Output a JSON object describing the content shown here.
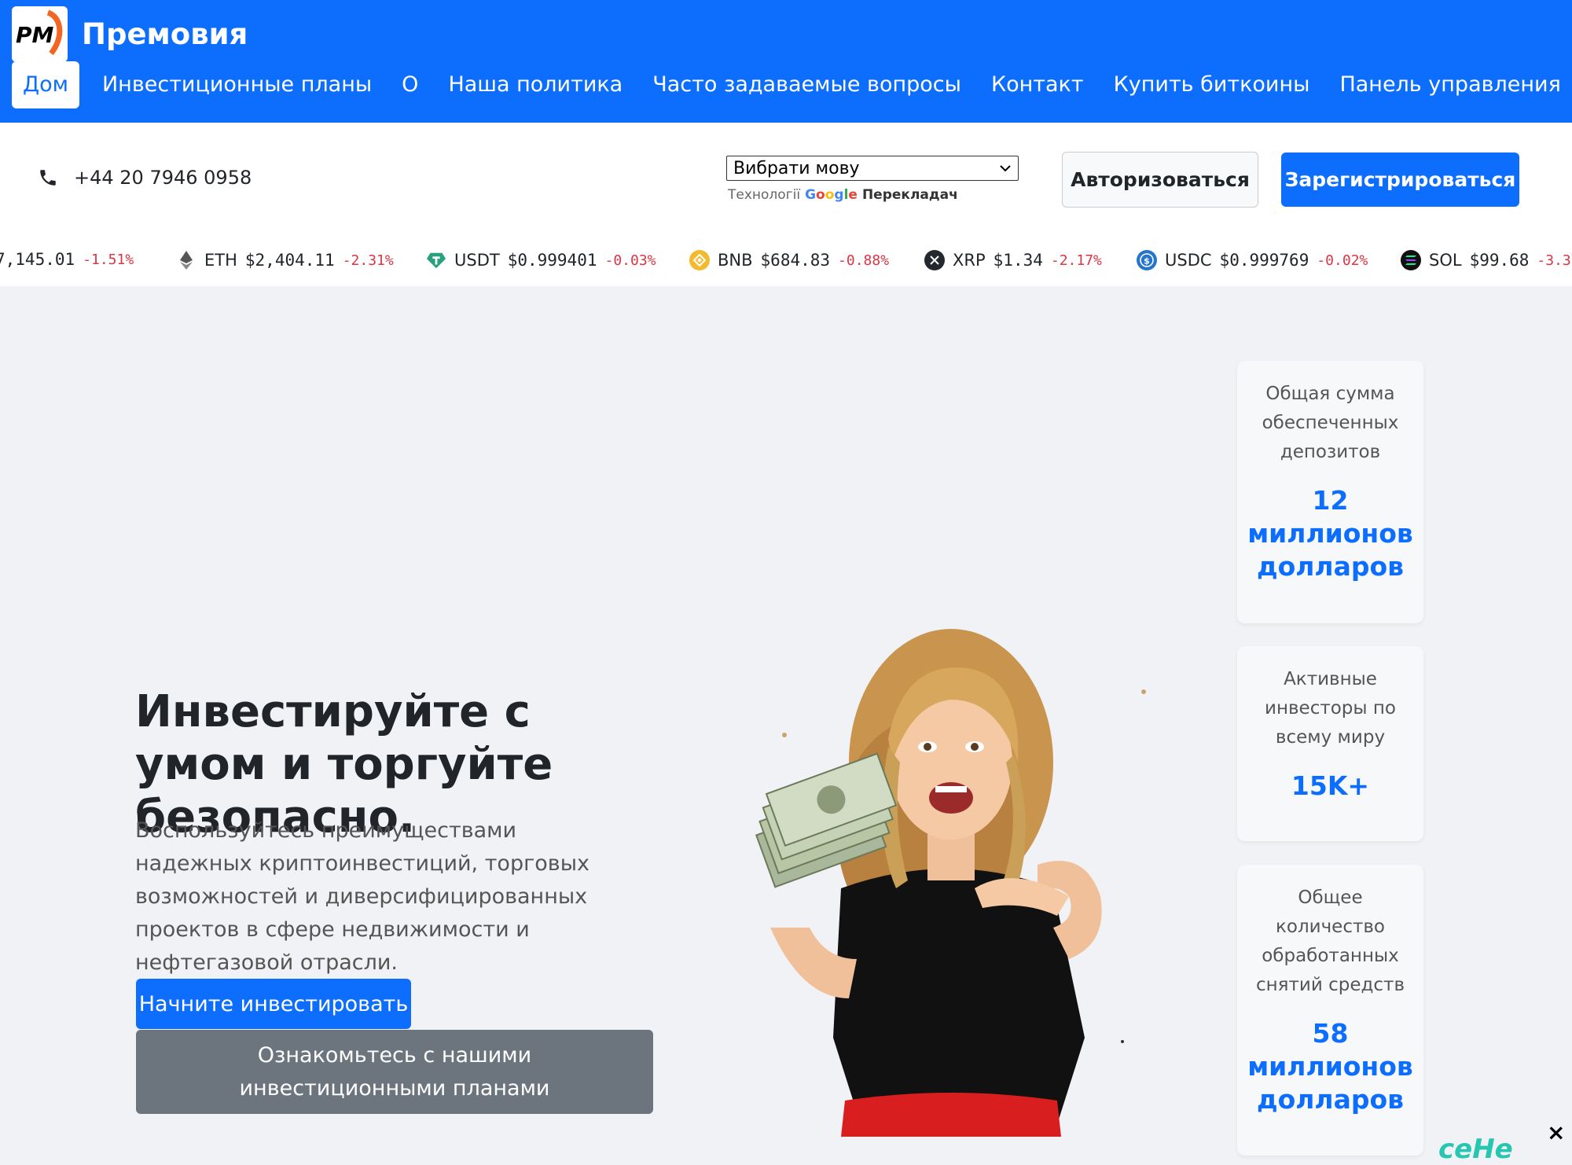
{
  "brand": {
    "name": "Премовия",
    "logo_text": "PM"
  },
  "nav": {
    "items": [
      {
        "label": "Дом",
        "active": true
      },
      {
        "label": "Инвестиционные планы",
        "active": false
      },
      {
        "label": "О",
        "active": false
      },
      {
        "label": "Наша политика",
        "active": false
      },
      {
        "label": "Часто задаваемые вопросы",
        "active": false
      },
      {
        "label": "Контакт",
        "active": false
      },
      {
        "label": "Купить биткоины",
        "active": false
      },
      {
        "label": "Панель управления",
        "active": false
      }
    ]
  },
  "contact": {
    "phone": "+44 20 7946 0958"
  },
  "translate": {
    "select_value": "Вибрати мову",
    "powered_prefix": "Технології",
    "google": "Google",
    "service": "Перекладач"
  },
  "auth": {
    "login_label": "Авторизоваться",
    "register_label": "Зарегистрироваться"
  },
  "ticker": [
    {
      "symbol": "",
      "price": "7,145.01",
      "change": "-1.51%",
      "icon": "btc-icon",
      "color": "#f7931a"
    },
    {
      "symbol": "ETH",
      "price": "$2,404.11",
      "change": "-2.31%",
      "icon": "eth-icon",
      "color": "#627eea"
    },
    {
      "symbol": "USDT",
      "price": "$0.999401",
      "change": "-0.03%",
      "icon": "usdt-icon",
      "color": "#26a17b"
    },
    {
      "symbol": "BNB",
      "price": "$684.83",
      "change": "-0.88%",
      "icon": "bnb-icon",
      "color": "#f3ba2f"
    },
    {
      "symbol": "XRP",
      "price": "$1.34",
      "change": "-2.17%",
      "icon": "xrp-icon",
      "color": "#23292f"
    },
    {
      "symbol": "USDC",
      "price": "$0.999769",
      "change": "-0.02%",
      "icon": "usdc-icon",
      "color": "#2775ca"
    },
    {
      "symbol": "SOL",
      "price": "$99.68",
      "change": "-3.3",
      "icon": "sol-icon",
      "color": "#111111"
    }
  ],
  "hero": {
    "title": "Инвестируйте с умом и торгуйте безопасно.",
    "text": "Воспользуйтесь преимуществами надежных криптоинвестиций, торговых возможностей и диверсифицированных проектов в сфере недвижимости и нефтегазовой отрасли.",
    "start_button": "Начните инвестировать",
    "plans_button": "Ознакомьтесь с нашими инвестиционными планами"
  },
  "stats": [
    {
      "label": "Общая сумма обеспеченных депозитов",
      "value": "12 миллионов долларов"
    },
    {
      "label": "Активные инвесторы по всему миру",
      "value": "15K+"
    },
    {
      "label": "Общее количество обработанных снятий средств",
      "value": "58 миллионов долларов"
    }
  ],
  "widget": {
    "close": "×",
    "chat_text": "ceHe"
  }
}
